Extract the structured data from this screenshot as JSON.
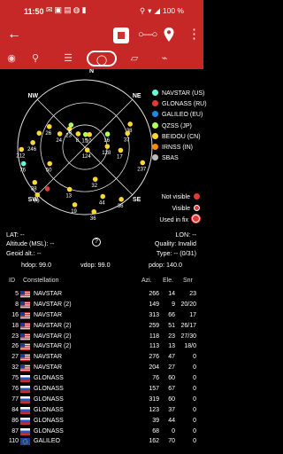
{
  "status_bar": {
    "time": "11:50",
    "battery": "100 %",
    "icons": [
      "mail-icon",
      "gallery-icon",
      "wallpaper-icon",
      "globe-icon",
      "sd-card-icon"
    ]
  },
  "toolbar": {
    "back_icon": "arrow-left-icon",
    "record_icon": "record-stop-icon",
    "route_icon": "route-icon",
    "location_icon": "location-pin-icon",
    "more_icon": "more-vert-icon"
  },
  "tabs": [
    {
      "icon": "compass-icon",
      "active": false
    },
    {
      "icon": "location-marker-icon",
      "active": false
    },
    {
      "icon": "list-icon",
      "active": false
    },
    {
      "icon": "sky-view-icon",
      "active": true
    },
    {
      "icon": "map-icon",
      "active": false
    },
    {
      "icon": "antenna-icon",
      "active": false
    }
  ],
  "skyplot": {
    "compass_labels": [
      "NW",
      "NE",
      "SW",
      "SE",
      "N"
    ],
    "satellites": [
      {
        "label": "26",
        "color": "#fdd835",
        "az": 300,
        "el": 35
      },
      {
        "label": "15",
        "color": "#b2ff59",
        "az": 3,
        "el": 73
      },
      {
        "label": "10",
        "color": "#fdd835",
        "az": 20,
        "el": 72
      },
      {
        "label": "16",
        "color": "#b2ff59",
        "az": 60,
        "el": 55
      },
      {
        "label": "38",
        "color": "#fdd835",
        "az": 63,
        "el": 22
      },
      {
        "label": "37",
        "color": "#fdd835",
        "az": 72,
        "el": 30
      },
      {
        "label": "17",
        "color": "#fdd835",
        "az": 95,
        "el": 42
      },
      {
        "label": "50",
        "color": "#fdd835",
        "az": 245,
        "el": 38
      },
      {
        "label": "23",
        "color": "#fdd835",
        "az": 320,
        "el": 58
      },
      {
        "label": "8",
        "color": "#fdd835",
        "az": 333,
        "el": 70
      },
      {
        "label": "8",
        "color": "#b2ff59",
        "az": 328,
        "el": 55
      },
      {
        "label": "24",
        "color": "#fdd835",
        "az": 298,
        "el": 52
      },
      {
        "label": "246",
        "color": "#fdd835",
        "az": 275,
        "el": 20
      },
      {
        "label": "212",
        "color": "#fdd835",
        "az": 268,
        "el": 5
      },
      {
        "label": "124",
        "color": "#fdd835",
        "az": 140,
        "el": 85
      },
      {
        "label": "128",
        "color": "#fdd835",
        "az": 88,
        "el": 60
      },
      {
        "label": "237",
        "color": "#fdd835",
        "az": 105,
        "el": 10
      },
      {
        "label": "44",
        "color": "#fdd835",
        "az": 160,
        "el": 20
      },
      {
        "label": "36",
        "color": "#fdd835",
        "az": 145,
        "el": 5
      },
      {
        "label": "32",
        "color": "#fdd835",
        "az": 162,
        "el": 45
      },
      {
        "label": "76",
        "color": "#64ffda",
        "az": 255,
        "el": 5
      },
      {
        "label": "13",
        "color": "#fdd835",
        "az": 200,
        "el": 30
      },
      {
        "label": "19",
        "color": "#fdd835",
        "az": 190,
        "el": 12
      },
      {
        "label": "79",
        "color": "#fdd835",
        "az": 225,
        "el": 0
      },
      {
        "label": "38",
        "color": "#fdd835",
        "az": 235,
        "el": 8
      },
      {
        "label": "36",
        "color": "#fdd835",
        "az": 172,
        "el": 3
      },
      {
        "label": "",
        "color": "#e53935",
        "az": 222,
        "el": 15
      },
      {
        "label": "",
        "color": "#fdd835",
        "az": 287,
        "el": 26
      }
    ]
  },
  "legend": [
    {
      "label": "NAVSTAR (US)",
      "color": "#64ffda"
    },
    {
      "label": "GLONASS (RU)",
      "color": "#e53935"
    },
    {
      "label": "GALILEO (EU)",
      "color": "#1e88e5"
    },
    {
      "label": "QZSS (JP)",
      "color": "#b2ff59"
    },
    {
      "label": "BEIDOU (CN)",
      "color": "#fdd835"
    },
    {
      "label": "IRNSS (IN)",
      "color": "#fb8c00"
    },
    {
      "label": "SBAS",
      "color": "#bdbdbd"
    }
  ],
  "status_legend": {
    "not_visible": "Not visible",
    "visible": "Visible",
    "used_in_fix": "Used in fix"
  },
  "info": {
    "lat": "LAT: --",
    "lon": "LON: --",
    "altitude": "Altitude (MSL): --",
    "quality": "Quality: Invalid",
    "geoid": "Geoid alt.: --",
    "type": "Type: -- (0/31)",
    "hdop": "hdop: 99.0",
    "vdop": "vdop: 99.0",
    "pdop": "pdop: 140.0",
    "help_icon": "help-icon",
    "help_label": "?"
  },
  "table": {
    "headers": {
      "id": "ID",
      "constellation": "Constellation",
      "azi": "Azi.",
      "ele": "Ele.",
      "snr": "Snr"
    },
    "rows": [
      {
        "id": "5",
        "flag": "us-flag-icon",
        "name": "NAVSTAR",
        "azi": "266",
        "ele": "14",
        "snr": "23"
      },
      {
        "id": "8",
        "flag": "us-flag-icon",
        "name": "NAVSTAR (2)",
        "azi": "149",
        "ele": "9",
        "snr": "20/20"
      },
      {
        "id": "16",
        "flag": "us-flag-icon",
        "name": "NAVSTAR",
        "azi": "313",
        "ele": "66",
        "snr": "17"
      },
      {
        "id": "18",
        "flag": "us-flag-icon",
        "name": "NAVSTAR (2)",
        "azi": "259",
        "ele": "51",
        "snr": "26/17"
      },
      {
        "id": "23",
        "flag": "us-flag-icon",
        "name": "NAVSTAR (2)",
        "azi": "118",
        "ele": "23",
        "snr": "27/30"
      },
      {
        "id": "26",
        "flag": "us-flag-icon",
        "name": "NAVSTAR (2)",
        "azi": "113",
        "ele": "13",
        "snr": "18/0"
      },
      {
        "id": "27",
        "flag": "us-flag-icon",
        "name": "NAVSTAR",
        "azi": "276",
        "ele": "47",
        "snr": "0"
      },
      {
        "id": "32",
        "flag": "us-flag-icon",
        "name": "NAVSTAR",
        "azi": "204",
        "ele": "27",
        "snr": "0"
      },
      {
        "id": "75",
        "flag": "ru-flag-icon",
        "name": "GLONASS",
        "azi": "76",
        "ele": "60",
        "snr": "0"
      },
      {
        "id": "76",
        "flag": "ru-flag-icon",
        "name": "GLONASS",
        "azi": "157",
        "ele": "67",
        "snr": "0"
      },
      {
        "id": "77",
        "flag": "ru-flag-icon",
        "name": "GLONASS",
        "azi": "319",
        "ele": "60",
        "snr": "0"
      },
      {
        "id": "84",
        "flag": "ru-flag-icon",
        "name": "GLONASS",
        "azi": "123",
        "ele": "37",
        "snr": "0"
      },
      {
        "id": "86",
        "flag": "ru-flag-icon",
        "name": "GLONASS",
        "azi": "39",
        "ele": "44",
        "snr": "0"
      },
      {
        "id": "87",
        "flag": "ru-flag-icon",
        "name": "GLONASS",
        "azi": "68",
        "ele": "0",
        "snr": "0"
      },
      {
        "id": "110",
        "flag": "eu-flag-icon",
        "name": "GALILEO",
        "azi": "162",
        "ele": "70",
        "snr": "0"
      }
    ]
  }
}
